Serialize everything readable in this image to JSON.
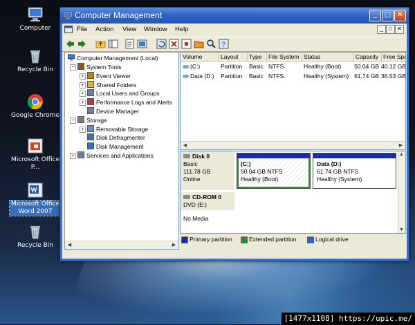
{
  "desktop": {
    "icons": [
      {
        "label": "Computer",
        "icon": "computer-icon"
      },
      {
        "label": "Recycle Bin",
        "icon": "recycle-bin-icon"
      },
      {
        "label": "Google Chrome",
        "icon": "chrome-icon"
      },
      {
        "label": "Microsoft Office P...",
        "icon": "powerpoint-icon"
      },
      {
        "label": "Microsoft Office Word 2007",
        "icon": "word-icon"
      },
      {
        "label": "Recycle Bin",
        "icon": "recycle-bin-icon"
      }
    ]
  },
  "window": {
    "title": "Computer Management",
    "controls": {
      "minimize": "_",
      "maximize": "□",
      "close": "✕"
    },
    "menu": [
      "File",
      "Action",
      "View",
      "Window",
      "Help"
    ],
    "menu_accel": [
      "F",
      "A",
      "V",
      "W",
      "H"
    ],
    "mdi_controls": [
      "_",
      "□",
      "✕"
    ]
  },
  "toolbar": {
    "icons": [
      "back-icon",
      "forward-icon",
      "up-folder-icon",
      "show-hide-tree-icon",
      "properties-icon",
      "help-icon",
      "refresh-icon",
      "delete-icon",
      "settings-icon",
      "folder-open-icon",
      "search-icon",
      "help-question-icon"
    ]
  },
  "tree": {
    "root": "Computer Management (Local)",
    "items": [
      {
        "label": "System Tools",
        "level": 1,
        "expander": "−",
        "icon": "tools-icon"
      },
      {
        "label": "Event Viewer",
        "level": 2,
        "expander": "+",
        "icon": "event-viewer-icon"
      },
      {
        "label": "Shared Folders",
        "level": 2,
        "expander": "+",
        "icon": "shared-folder-icon"
      },
      {
        "label": "Local Users and Groups",
        "level": 2,
        "expander": "+",
        "icon": "users-icon"
      },
      {
        "label": "Performance Logs and Alerts",
        "level": 2,
        "expander": "+",
        "icon": "performance-icon"
      },
      {
        "label": "Device Manager",
        "level": 2,
        "expander": "",
        "icon": "device-manager-icon"
      },
      {
        "label": "Storage",
        "level": 1,
        "expander": "−",
        "icon": "storage-icon"
      },
      {
        "label": "Removable Storage",
        "level": 2,
        "expander": "+",
        "icon": "removable-storage-icon"
      },
      {
        "label": "Disk Defragmenter",
        "level": 2,
        "expander": "",
        "icon": "defrag-icon"
      },
      {
        "label": "Disk Management",
        "level": 2,
        "expander": "",
        "icon": "disk-management-icon"
      },
      {
        "label": "Services and Applications",
        "level": 1,
        "expander": "+",
        "icon": "services-icon"
      }
    ]
  },
  "volumes": {
    "columns": [
      "Volume",
      "Layout",
      "Type",
      "File System",
      "Status",
      "Capacity",
      "Free Spa"
    ],
    "rows": [
      {
        "volume": "(C:)",
        "layout": "Partition",
        "type": "Basic",
        "fs": "NTFS",
        "status": "Healthy (Boot)",
        "capacity": "50.04 GB",
        "free": "40.12 GB"
      },
      {
        "volume": "Data (D:)",
        "layout": "Partition",
        "type": "Basic",
        "fs": "NTFS",
        "status": "Healthy (System)",
        "capacity": "61.74 GB",
        "free": "36.53 GB"
      }
    ]
  },
  "disks": [
    {
      "name": "Disk 0",
      "type": "Basic",
      "size": "111.78 GB",
      "state": "Online",
      "partitions": [
        {
          "name": "(C:)",
          "size": "50.04 GB NTFS",
          "status": "Healthy (Boot)"
        },
        {
          "name": "Data  (D:)",
          "size": "61.74 GB NTFS",
          "status": "Healthy (System)"
        }
      ]
    },
    {
      "name": "CD-ROM 0",
      "type": "DVD (E:)",
      "media": "No Media"
    }
  ],
  "legend": [
    {
      "label": "Primary partition",
      "color": "#1c2f9c"
    },
    {
      "label": "Extended partition",
      "color": "#2d8a2d"
    },
    {
      "label": "Logical drive",
      "color": "#2c5fd6"
    }
  ],
  "watermark": "[1477x1108] https://upic.me/"
}
